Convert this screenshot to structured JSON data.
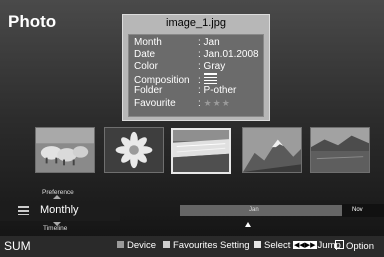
{
  "screen": {
    "title": "Photo"
  },
  "info": {
    "filename": "image_1.jpg",
    "rows": [
      {
        "key": "Month",
        "value": ": Jan"
      },
      {
        "key": "Date",
        "value": ": Jan.01.2008"
      },
      {
        "key": "Color",
        "value": ": Gray"
      },
      {
        "key": "Composition",
        "value": ":"
      },
      {
        "key": "Folder",
        "value": ": P-other"
      },
      {
        "key": "Favourite",
        "value": ":"
      }
    ],
    "favourite_stars": "★★★",
    "composition_icon": "composition-lines-icon"
  },
  "thumbnails": [
    {
      "subject": "sheep"
    },
    {
      "subject": "flower"
    },
    {
      "subject": "waterfall",
      "selected": true
    },
    {
      "subject": "mountain"
    },
    {
      "subject": "lake"
    }
  ],
  "sort_menu": {
    "above": "Preference",
    "current": "Monthly",
    "below": "Timeline"
  },
  "timeline": {
    "current_month": "Jan",
    "end_month": "Nov"
  },
  "bottom_bar": {
    "source": "SUM",
    "device": "Device",
    "favourites": "Favourites Setting",
    "select": "Select",
    "jump": "Jump",
    "option": "Option"
  },
  "colors": {
    "device_key": "#9a9a9a",
    "favourites_key": "#cfcfcf",
    "select_key": "#e6e6e6"
  }
}
